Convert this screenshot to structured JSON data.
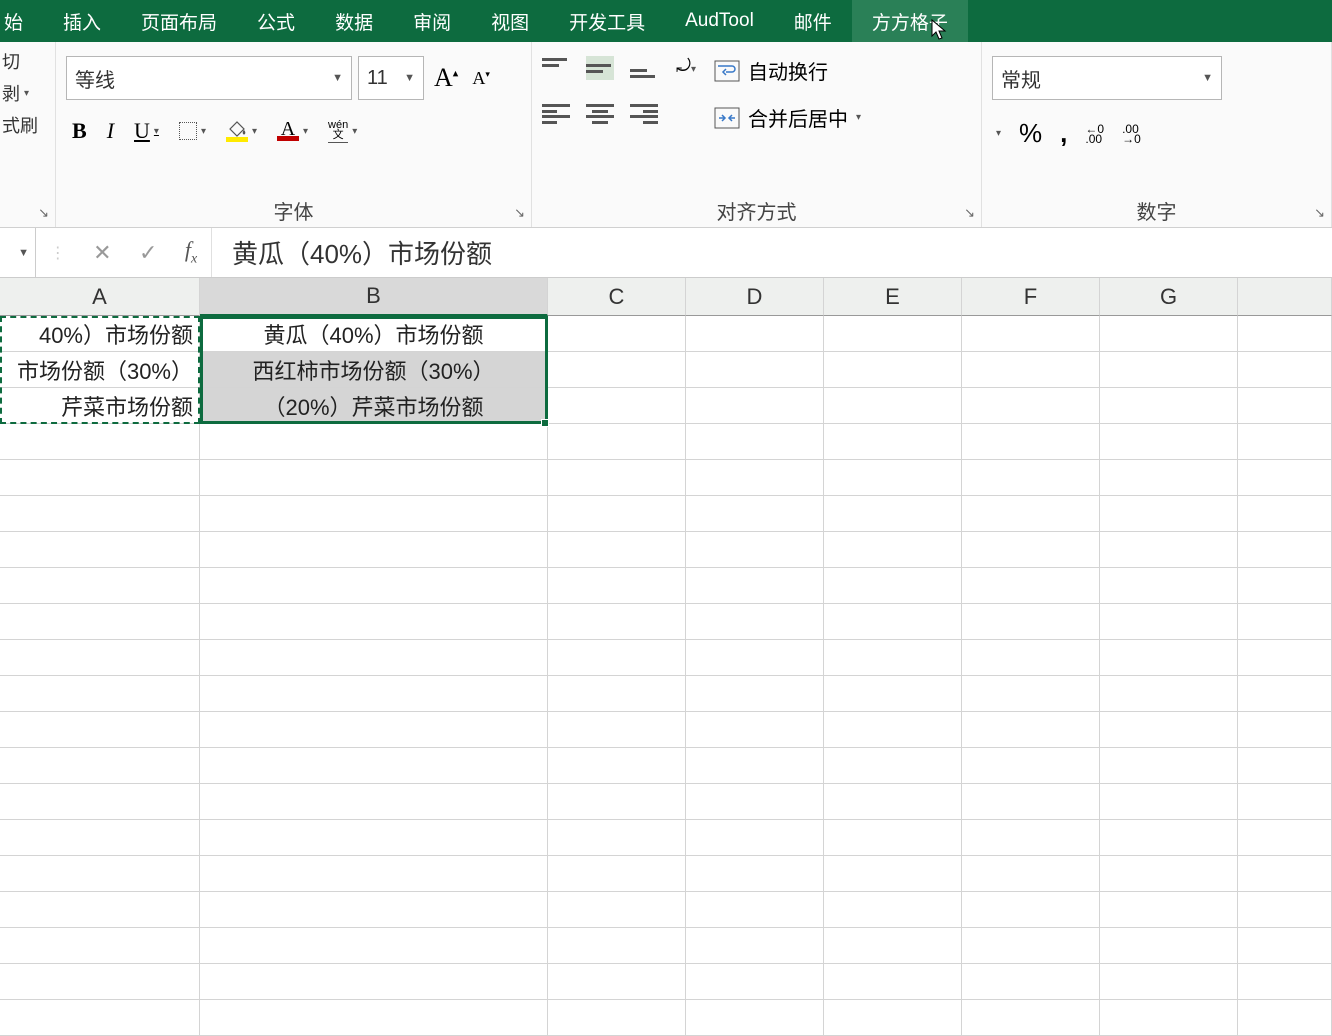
{
  "ribbon": {
    "tabs": [
      "始",
      "插入",
      "页面布局",
      "公式",
      "数据",
      "审阅",
      "视图",
      "开发工具",
      "AudTool",
      "邮件",
      "方方格子"
    ],
    "active_tab": 0,
    "hover_tab": 10
  },
  "clipboard": {
    "items": [
      "切",
      "剥",
      "式刷"
    ]
  },
  "font": {
    "group_label": "字体",
    "name": "等线",
    "size": "11",
    "wen_top": "wén",
    "wen_bot": "文"
  },
  "alignment": {
    "group_label": "对齐方式",
    "wrap_label": "自动换行",
    "merge_label": "合并后居中"
  },
  "number": {
    "group_label": "数字",
    "format": "常规",
    "dec_inc_top": "←0",
    "dec_inc_bot": ".00",
    "dec_dec_top": ".00",
    "dec_dec_bot": "→0"
  },
  "formula_bar": {
    "content": "黄瓜（40%）市场份额"
  },
  "columns": [
    "A",
    "B",
    "C",
    "D",
    "E",
    "F",
    "G"
  ],
  "cells": {
    "A": [
      "40%）市场份额",
      "市场份额（30%）",
      "芹菜市场份额"
    ],
    "B": [
      "黄瓜（40%）市场份额",
      "西红柿市场份额（30%）",
      "（20%）芹菜市场份额"
    ]
  },
  "empty_rows": 17
}
